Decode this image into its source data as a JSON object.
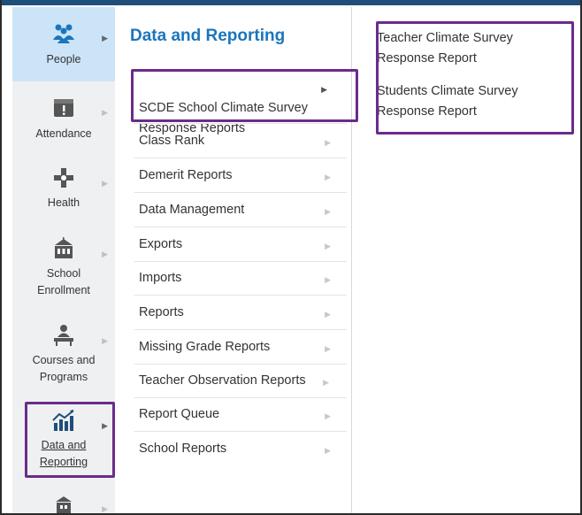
{
  "leftnav": {
    "items": [
      {
        "label": "People",
        "icon": "people-icon"
      },
      {
        "label": "Attendance",
        "icon": "attendance-icon"
      },
      {
        "label": "Health",
        "icon": "health-icon"
      },
      {
        "label": "School\nEnrollment",
        "icon": "school-icon"
      },
      {
        "label": "Courses and\nPrograms",
        "icon": "teacher-desk-icon"
      },
      {
        "label": "Data and\nReporting",
        "icon": "chart-icon"
      },
      {
        "label": "",
        "icon": "building-icon"
      }
    ]
  },
  "panel": {
    "title": "Data and Reporting",
    "items": [
      "SCDE School Climate Survey\nResponse Reports",
      "Class Rank",
      "Demerit Reports",
      "Data Management",
      "Exports",
      "Imports",
      "Reports",
      "Missing Grade Reports",
      "Teacher Observation Reports",
      "Report Queue",
      "School Reports"
    ]
  },
  "subpanel": {
    "items": [
      "Teacher Climate Survey\nResponse Report",
      "Students Climate Survey\nResponse Report"
    ]
  },
  "colors": {
    "accent": "#1b75bc",
    "highlight_border": "#6a2c8b",
    "active_nav_bg": "#cce4f7"
  }
}
